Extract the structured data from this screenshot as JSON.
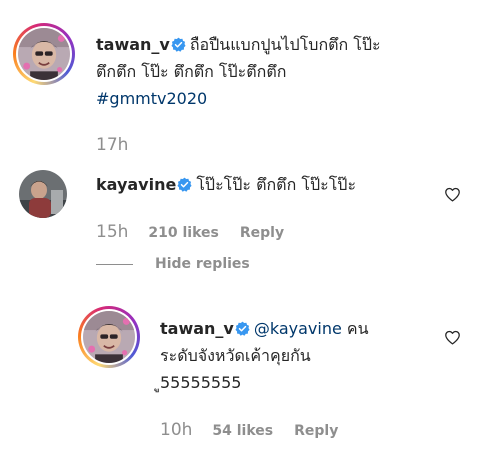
{
  "comments": [
    {
      "username": "tawan_v",
      "lines": [
        "ถือปืนแบกปูนไปโบกตึก โป๊ะ",
        "ตึกตึก โป๊ะ ตึกตึก โป๊ะตึกตึก"
      ],
      "hashtag": "#gmmtv2020",
      "time": "17h"
    },
    {
      "username": "kayavine",
      "text": "โป๊ะโป๊ะ ตึกตึก โป๊ะโป๊ะ",
      "time": "15h",
      "likes": "210 likes",
      "reply": "Reply"
    }
  ],
  "hide_replies": "Hide replies",
  "reply_comment": {
    "username": "tawan_v",
    "mention": "@kayavine",
    "line1_rest": "คน",
    "line2": "ระดับจังหวัดเค้าคุยกัน",
    "line3": "ู55555555",
    "time": "10h",
    "likes": "54 likes",
    "reply": "Reply"
  },
  "colors": {
    "text": "#262626",
    "secondary": "#8e8e8e",
    "link": "#00376b",
    "verified": "#3897f0"
  },
  "icons": {
    "verified": "verified-badge-icon",
    "like": "heart-outline-icon"
  }
}
